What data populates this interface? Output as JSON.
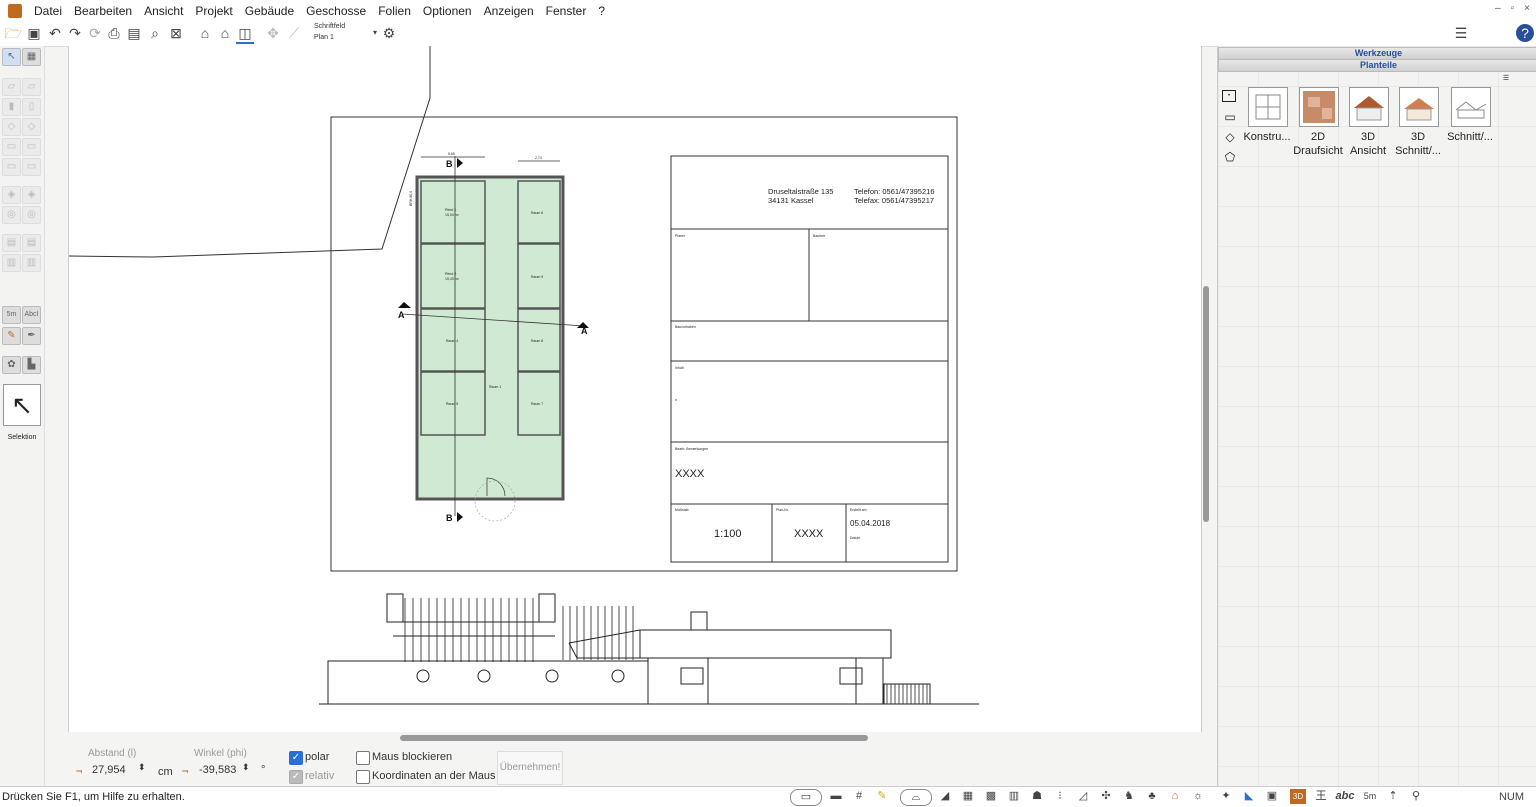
{
  "menu": [
    "Datei",
    "Bearbeiten",
    "Ansicht",
    "Projekt",
    "Gebäude",
    "Geschosse",
    "Folien",
    "Optionen",
    "Anzeigen",
    "Fenster",
    "?"
  ],
  "window_controls": [
    "–",
    "▫",
    "×"
  ],
  "toolbar": {
    "schriftfeld": "Schriftfeld",
    "plan": "Plan 1",
    "icons": [
      "open-folder",
      "save",
      "undo",
      "redo",
      "print",
      "print-preview",
      "zoom",
      "zoom-window",
      "house-3d",
      "roof",
      "view",
      "measure",
      "dimension",
      "camera"
    ]
  },
  "left_tools": {
    "selection_label": "Selektion",
    "dim_label": "5m",
    "text_label": "AbcI"
  },
  "title_block": {
    "address_line1": "Druseltalstraße 135",
    "address_line2": "34131 Kassel",
    "phone": "Telefon: 0561/47395216",
    "fax": "Telefax: 0561/47395217",
    "field_planer": "Planer",
    "field_bauherr": "Bauherr",
    "field_bauvorhaben": "Bauvorhaben",
    "field_inhalt": "Inhalt",
    "inhalt_value": "x",
    "field_bemerkungen": "Bearb. Bemerkungen",
    "remarks_value": "XXXX",
    "field_massstab": "Maßstab",
    "scale_value": "1:100",
    "field_plannr": "Plan-Nr.",
    "plannr_value": "XXXX",
    "field_erstellt": "Erstellt am",
    "date_value": "05.04.2018",
    "field_datum": "Datum"
  },
  "floorplan": {
    "rooms": [
      {
        "name": "Pferd 1",
        "area": "15,04 m²"
      },
      {
        "name": "Pferd 2",
        "area": "15,43 m²"
      },
      {
        "name": "Raum 4",
        "area": ""
      },
      {
        "name": "Raum 5",
        "area": ""
      },
      {
        "name": "Raum 1",
        "area": ""
      },
      {
        "name": "Raum 6",
        "area": ""
      },
      {
        "name": "Raum 9",
        "area": ""
      },
      {
        "name": "Raum 8",
        "area": ""
      },
      {
        "name": "Raum 7",
        "area": ""
      }
    ],
    "section_a": "A",
    "section_b": "B",
    "dim_top_left": "5,65",
    "dim_top_right": "2,74",
    "side_dim": "BRH 80,0"
  },
  "coordinates": {
    "distance_label": "Abstand (l)",
    "distance_value": "27,954",
    "distance_unit": "cm",
    "angle_label": "Winkel (phi)",
    "angle_value": "-39,583",
    "angle_unit": "°",
    "polar_label": "polar",
    "relative_label": "relativ",
    "lock_mouse_label": "Maus blockieren",
    "coords_at_mouse_label": "Koordinaten an der Maus",
    "apply_label": "Übernehmen!"
  },
  "status": {
    "hint": "Drücken Sie F1, um Hilfe zu erhalten.",
    "num": "NUM",
    "icons_3d": "3D",
    "icons_abc": "abc",
    "icons_5m": "5m"
  },
  "right_panel": {
    "header_tools": "Werkzeuge",
    "header_parts": "Planteile",
    "thumbnails": [
      {
        "line1": "Konstru...",
        "line2": ""
      },
      {
        "line1": "2D",
        "line2": "Draufsicht"
      },
      {
        "line1": "3D",
        "line2": "Ansicht"
      },
      {
        "line1": "3D",
        "line2": "Schnitt/..."
      },
      {
        "line1": "Schnitt/...",
        "line2": ""
      }
    ]
  },
  "colors": {
    "room_fill": "#cfe9d2",
    "accent_blue": "#2a6fd6",
    "header_text": "#2a4f9a"
  }
}
